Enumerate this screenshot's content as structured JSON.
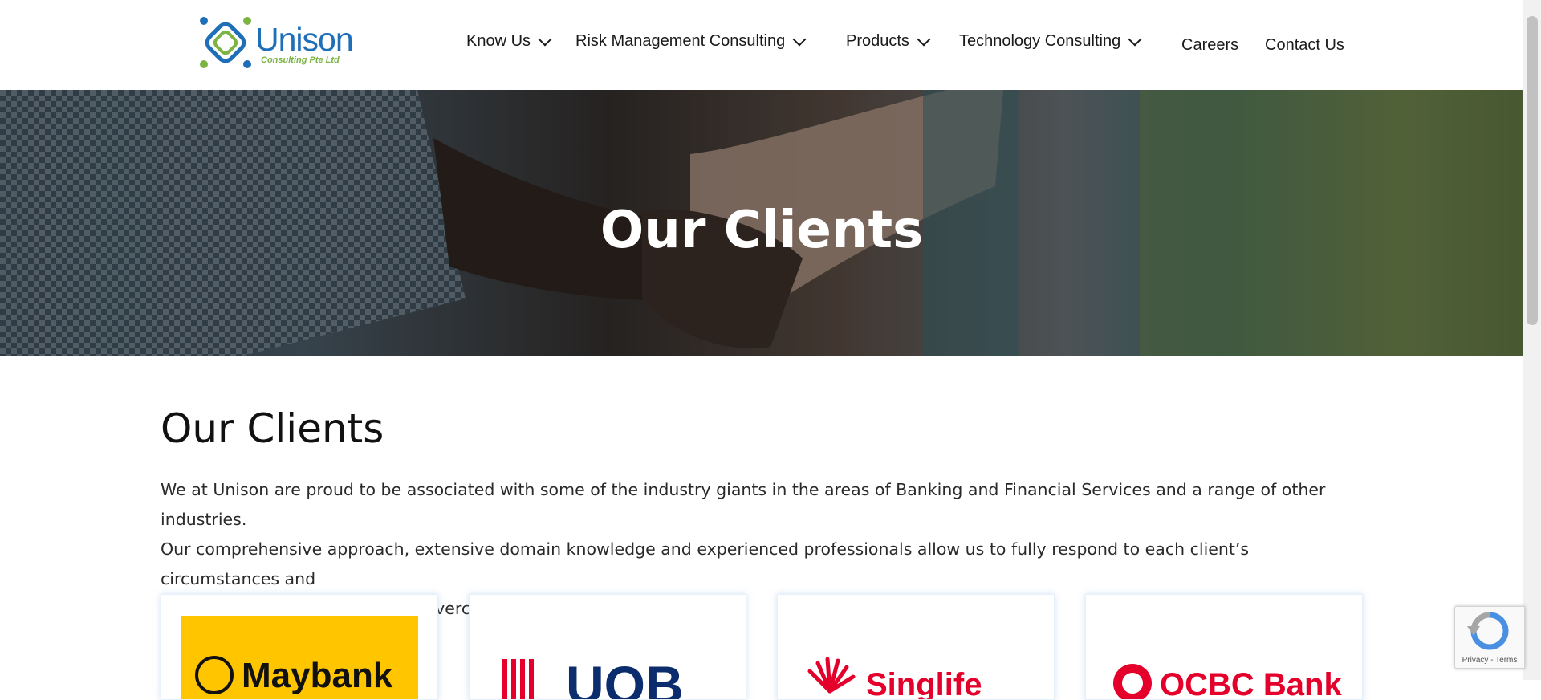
{
  "header": {
    "logo": {
      "name": "Unison",
      "tagline": "Consulting Pte Ltd",
      "colors": {
        "blue": "#1e6fb8",
        "green": "#7cb342"
      }
    },
    "nav": [
      {
        "label": "Know Us",
        "has_dropdown": true
      },
      {
        "label": "Risk Management Consulting",
        "has_dropdown": true
      },
      {
        "label": "Products",
        "has_dropdown": true
      },
      {
        "label": "Technology Consulting",
        "has_dropdown": true
      },
      {
        "label": "Careers",
        "has_dropdown": false
      },
      {
        "label": "Contact Us",
        "has_dropdown": false
      }
    ]
  },
  "hero": {
    "title": "Our Clients"
  },
  "main": {
    "title": "Our Clients",
    "intro": [
      "We at Unison are proud to be associated with some of the industry giants in the areas of Banking and Financial Services and a range of other industries.",
      "Our comprehensive approach, extensive domain knowledge and experienced professionals allow us to fully respond to each client’s circumstances and",
      "requirements and consult them overcome their problems."
    ]
  },
  "clients": [
    {
      "name": "Maybank",
      "color": "#ffc600"
    },
    {
      "name": "UOB",
      "color": "#0b2d6e",
      "accent": "#e4002b"
    },
    {
      "name": "Singlife",
      "color": "#e4002b"
    },
    {
      "name": "OCBC Bank",
      "color": "#e4002b"
    }
  ],
  "recaptcha": {
    "links": "Privacy - Terms"
  }
}
